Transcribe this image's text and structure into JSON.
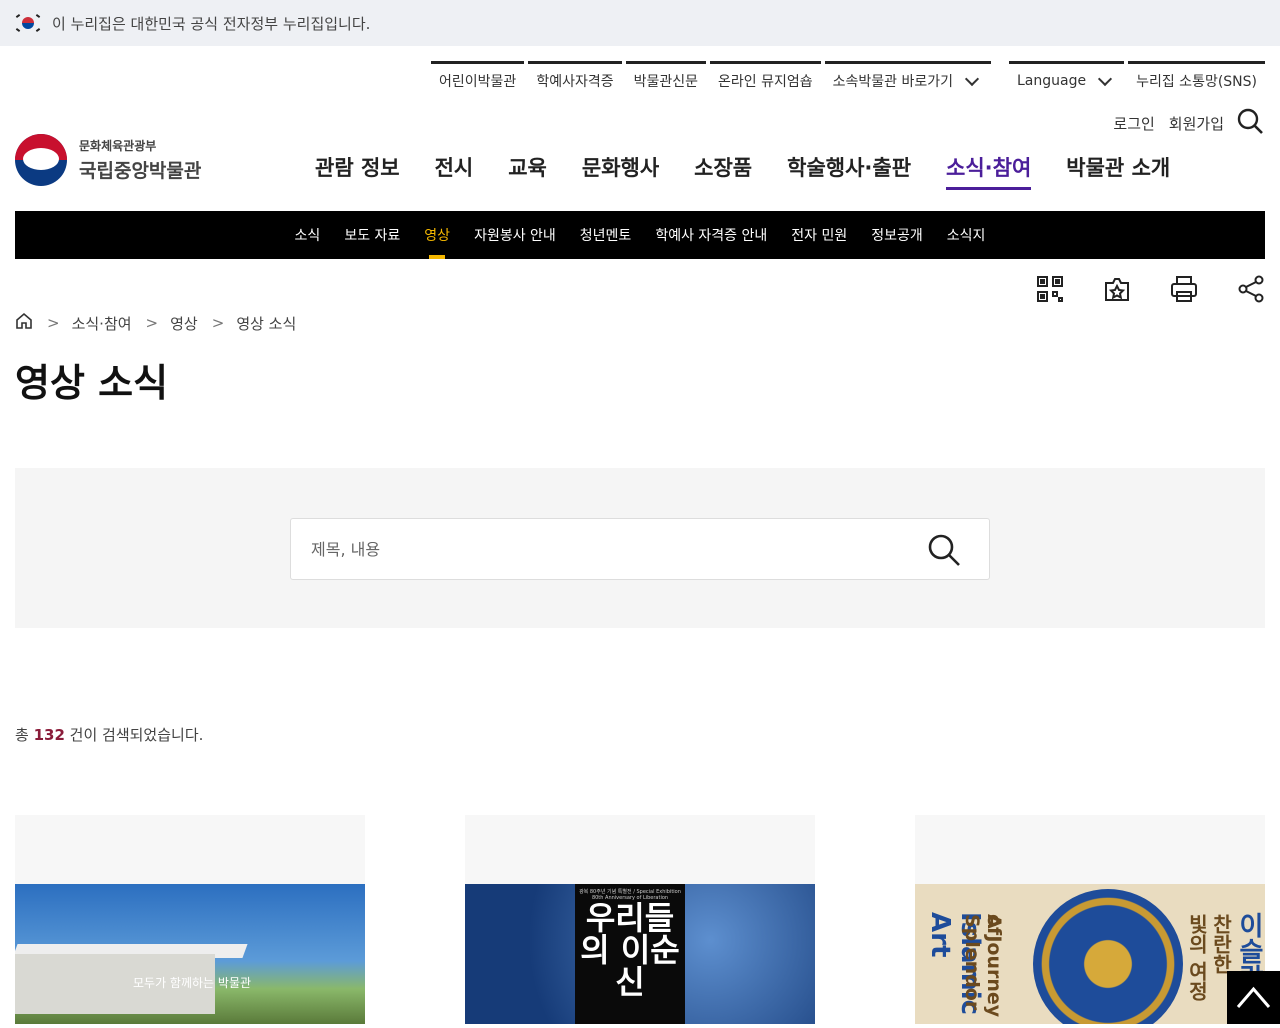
{
  "gov_banner": {
    "text": "이 누리집은 대한민국 공식 전자정부 누리집입니다."
  },
  "utility_links": [
    {
      "label": "어린이박물관"
    },
    {
      "label": "학예사자격증"
    },
    {
      "label": "박물관신문"
    },
    {
      "label": "온라인 뮤지엄숍"
    },
    {
      "label": "소속박물관 바로가기"
    }
  ],
  "utility_links_right": [
    {
      "label": "Language"
    },
    {
      "label": "누리집 소통망(SNS)"
    }
  ],
  "account": {
    "login": "로그인",
    "signup": "회원가입"
  },
  "logo": {
    "ministry": "문화체육관광부",
    "museum": "국립중앙박물관"
  },
  "main_nav": [
    {
      "label": "관람 정보"
    },
    {
      "label": "전시"
    },
    {
      "label": "교육"
    },
    {
      "label": "문화행사"
    },
    {
      "label": "소장품"
    },
    {
      "label": "학술행사·출판"
    },
    {
      "label": "소식·참여"
    },
    {
      "label": "박물관 소개"
    }
  ],
  "sub_nav": [
    {
      "label": "소식"
    },
    {
      "label": "보도 자료"
    },
    {
      "label": "영상"
    },
    {
      "label": "자원봉사 안내"
    },
    {
      "label": "청년멘토"
    },
    {
      "label": "학예사 자격증 안내"
    },
    {
      "label": "전자 민원"
    },
    {
      "label": "정보공개"
    },
    {
      "label": "소식지"
    }
  ],
  "breadcrumb": [
    "소식·참여",
    "영상",
    "영상 소식"
  ],
  "page_title": "영상 소식",
  "search": {
    "placeholder": "제목, 내용"
  },
  "result": {
    "prefix": "총 ",
    "count": "132",
    "suffix": " 건이 검색되었습니다."
  },
  "cards": [
    {
      "caption": "모두가 함께하는 박물관"
    },
    {
      "poster_sub": "광복 80주년 기념 특별전 / Special Exhibition 80th Anniversary of Liberation",
      "poster_title": "우리들의 이순신"
    },
    {
      "title_ko_1": "이슬람",
      "title_ko_2": "찬란한",
      "title_ko_3": "빛의 여정",
      "title_en_1": "A Journey",
      "title_en_2": "of Splendor",
      "title_en_3": "Islamic Art"
    }
  ],
  "colors": {
    "accent_purple": "#4b1e9a",
    "sub_active": "#f5b800",
    "count_red": "#8a1c3a"
  }
}
